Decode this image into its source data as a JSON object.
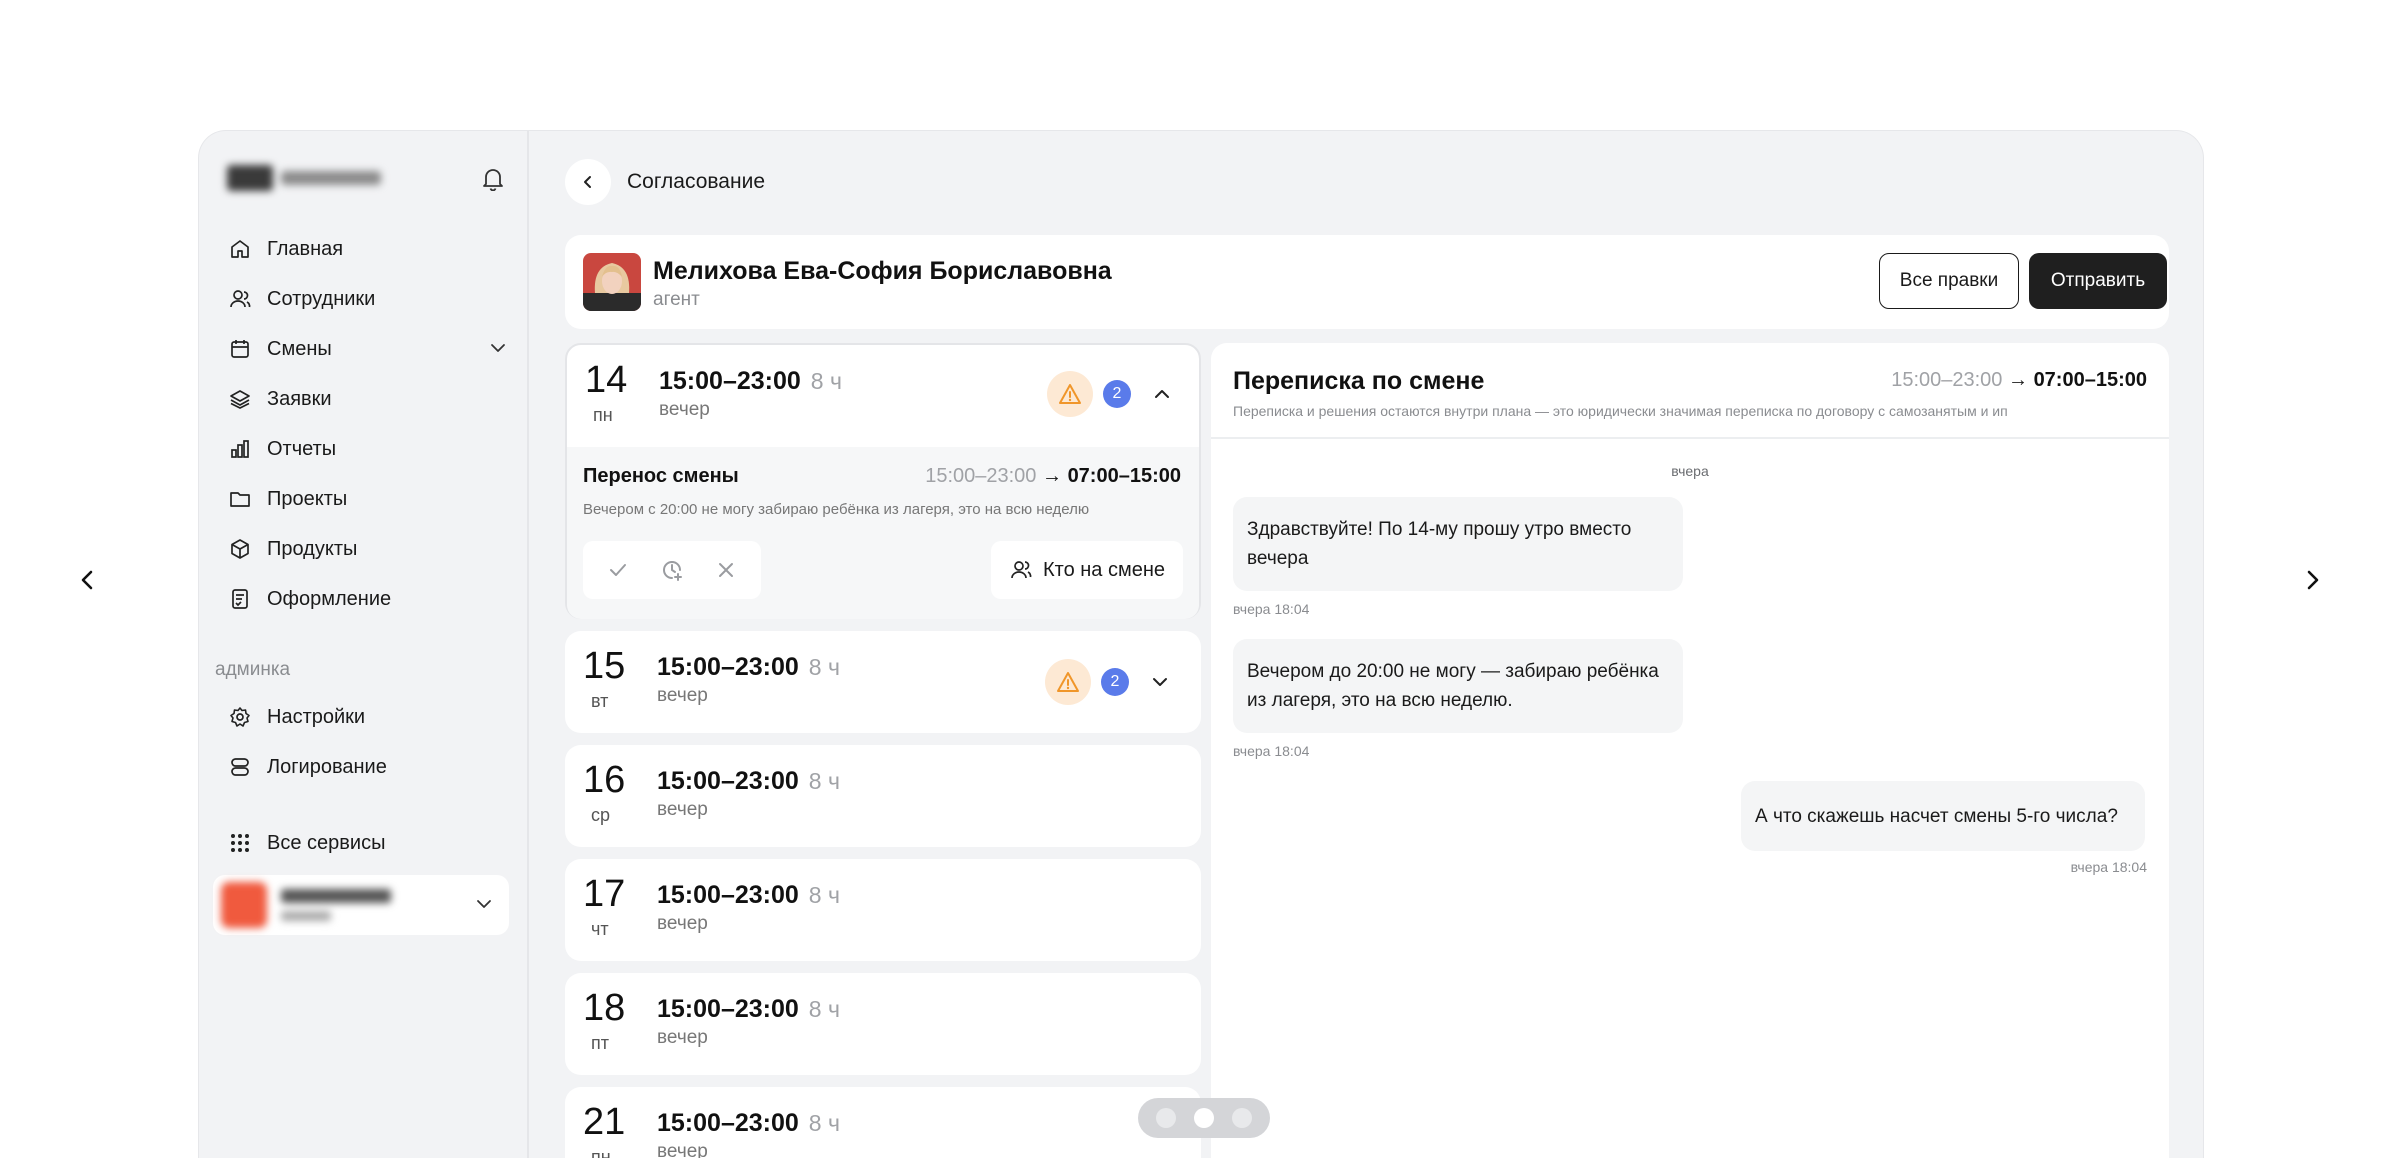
{
  "sidebar": {
    "nav": [
      {
        "label": "Главная",
        "icon": "home-icon"
      },
      {
        "label": "Сотрудники",
        "icon": "users-icon"
      },
      {
        "label": "Смены",
        "icon": "calendar-icon"
      },
      {
        "label": "Заявки",
        "icon": "layers-icon"
      },
      {
        "label": "Отчеты",
        "icon": "bar-chart-icon"
      },
      {
        "label": "Проекты",
        "icon": "folder-icon"
      },
      {
        "label": "Продукты",
        "icon": "box-icon"
      },
      {
        "label": "Оформление",
        "icon": "document-icon"
      }
    ],
    "admin_title": "админка",
    "admin": [
      {
        "label": "Настройки",
        "icon": "gear-icon"
      },
      {
        "label": "Логирование",
        "icon": "database-icon"
      }
    ],
    "all_services": "Все сервисы"
  },
  "header": {
    "title": "Согласование"
  },
  "person": {
    "name": "Мелихова Ева-София Бориславовна",
    "role": "агент"
  },
  "buttons": {
    "all_edits": "Все правки",
    "send": "Отправить"
  },
  "shifts": [
    {
      "day": "14",
      "weekday": "пн",
      "time": "15:00–23:00",
      "duration": "8 ч",
      "period": "вечер",
      "badge": "2"
    },
    {
      "day": "15",
      "weekday": "вт",
      "time": "15:00–23:00",
      "duration": "8 ч",
      "period": "вечер",
      "badge": "2"
    },
    {
      "day": "16",
      "weekday": "ср",
      "time": "15:00–23:00",
      "duration": "8 ч",
      "period": "вечер"
    },
    {
      "day": "17",
      "weekday": "чт",
      "time": "15:00–23:00",
      "duration": "8 ч",
      "period": "вечер"
    },
    {
      "day": "18",
      "weekday": "пт",
      "time": "15:00–23:00",
      "duration": "8 ч",
      "period": "вечер"
    },
    {
      "day": "21",
      "weekday": "пн",
      "time": "15:00–23:00",
      "duration": "8 ч",
      "period": "вечер"
    }
  ],
  "request": {
    "title": "Перенос смены",
    "old_range": "15:00–23:00",
    "arrow": "→",
    "new_range": "07:00–15:00",
    "description": "Вечером с 20:00 не могу забираю ребёнка из лагеря, это на всю неделю",
    "who_on_shift": "Кто на смене"
  },
  "chat": {
    "title": "Переписка по смене",
    "old_range": "15:00–23:00",
    "arrow": "→",
    "new_range": "07:00–15:00",
    "subtitle": "Переписка и решения остаются внутри плана — это юридически значимая переписка по договору с самозанятым и ип",
    "day_label": "вчера",
    "messages": [
      {
        "text": "Здравствуйте! По 14-му прошу утро вместо вечера",
        "time": "вчера 18:04",
        "side": "left"
      },
      {
        "text": "Вечером до 20:00 не могу — забираю ребёнка из лагеря, это на всю неделю.",
        "time": "вчера 18:04",
        "side": "left"
      },
      {
        "text": "А что скажешь насчет смены  5-го числа?",
        "time": "вчера 18:04",
        "side": "right"
      }
    ]
  },
  "colors": {
    "accent_badge": "#5a7bea",
    "warning_bg": "#fde9d4",
    "warning_icon": "#f0962a",
    "primary_button": "#1f1f1f"
  }
}
